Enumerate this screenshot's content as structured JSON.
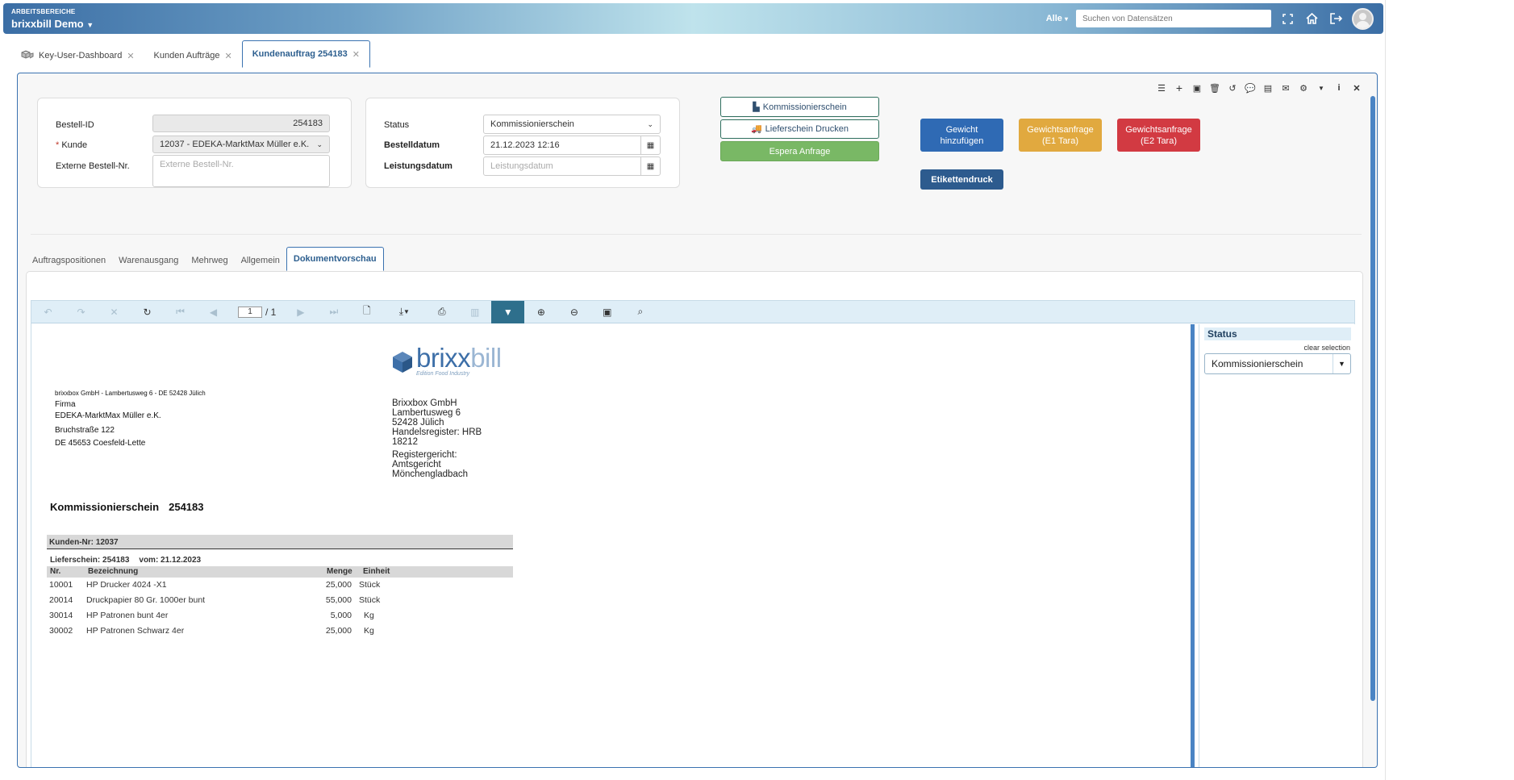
{
  "header": {
    "workspace_label": "ARBEITSBEREICHE",
    "workspace_name": "brixxbill Demo",
    "scope": "Alle",
    "search_placeholder": "Suchen von Datensätzen"
  },
  "page_tabs": [
    {
      "label": "Key-User-Dashboard",
      "active": false
    },
    {
      "label": "Kunden Aufträge",
      "active": false
    },
    {
      "label": "Kundenauftrag 254183",
      "active": true
    }
  ],
  "form_left": {
    "order_id_label": "Bestell-ID",
    "order_id_value": "254183",
    "customer_label": "Kunde",
    "customer_required": "*",
    "customer_value": "12037 - EDEKA-MarktMax Müller e.K.",
    "external_label": "Externe Bestell-Nr.",
    "external_placeholder": "Externe Bestell-Nr."
  },
  "form_right": {
    "status_label": "Status",
    "status_value": "Kommissionierschein",
    "order_date_label": "Bestelldatum",
    "order_date_value": "21.12.2023 12:16",
    "service_date_label": "Leistungsdatum",
    "service_date_placeholder": "Leistungsdatum"
  },
  "actions": {
    "picking_slip": "Kommissionierschein",
    "print_delivery": "Lieferschein Drucken",
    "espera": "Espera Anfrage",
    "add_weight_1": "Gewicht",
    "add_weight_2": "hinzufügen",
    "weight_e1_1": "Gewichtsanfrage",
    "weight_e1_2": "(E1 Tara)",
    "weight_e2_1": "Gewichtsanfrage",
    "weight_e2_2": "(E2 Tara)",
    "label_print": "Etikettendruck"
  },
  "inner_tabs": [
    {
      "label": "Auftragspositionen",
      "active": false
    },
    {
      "label": "Warenausgang",
      "active": false
    },
    {
      "label": "Mehrweg",
      "active": false
    },
    {
      "label": "Allgemein",
      "active": false
    },
    {
      "label": "Dokumentvorschau",
      "active": true
    }
  ],
  "viewer": {
    "page_current": "1",
    "page_total": "/ 1",
    "side_title": "Status",
    "clear_selection": "clear selection",
    "status_filter": "Kommissionierschein"
  },
  "document": {
    "logo_main": "brixx",
    "logo_light": "bill",
    "logo_sub": "Edition Food Industry",
    "sender_line": "brixxbox GmbH  -  Lambertusweg 6  -  DE 52428 Jülich",
    "recipient": [
      "Firma",
      "EDEKA-MarktMax Müller e.K.",
      "Bruchstraße 122",
      "DE 45653 Coesfeld-Lette"
    ],
    "company_block": [
      "Brixxbox GmbH",
      "Lambertusweg 6",
      "52428 Jülich",
      "Handelsregister: HRB",
      "18212",
      "Registergericht:",
      "Amtsgericht",
      "Mönchengladbach"
    ],
    "title": "Kommissionierschein",
    "title_number": "254183",
    "customer_number": "Kunden-Nr: 12037",
    "delivery_note": "Lieferschein: 254183",
    "delivery_date": "vom: 21.12.2023",
    "columns": {
      "nr": "Nr.",
      "desc": "Bezeichnung",
      "qty": "Menge",
      "unit": "Einheit"
    },
    "rows": [
      {
        "nr": "10001",
        "desc": "HP Drucker 4024 -X1",
        "qty": "25,000",
        "unit": "Stück"
      },
      {
        "nr": "20014",
        "desc": "Druckpapier 80 Gr. 1000er bunt",
        "qty": "55,000",
        "unit": "Stück"
      },
      {
        "nr": "30014",
        "desc": "HP Patronen bunt 4er",
        "qty": "5,000",
        "unit": "Kg"
      },
      {
        "nr": "30002",
        "desc": "HP Patronen Schwarz 4er",
        "qty": "25,000",
        "unit": "Kg"
      }
    ]
  },
  "colors": {
    "primary": "#3a72b0",
    "green": "#79b865",
    "orange": "#e1a93f",
    "red": "#d23a42",
    "navy": "#2d5b8e"
  }
}
